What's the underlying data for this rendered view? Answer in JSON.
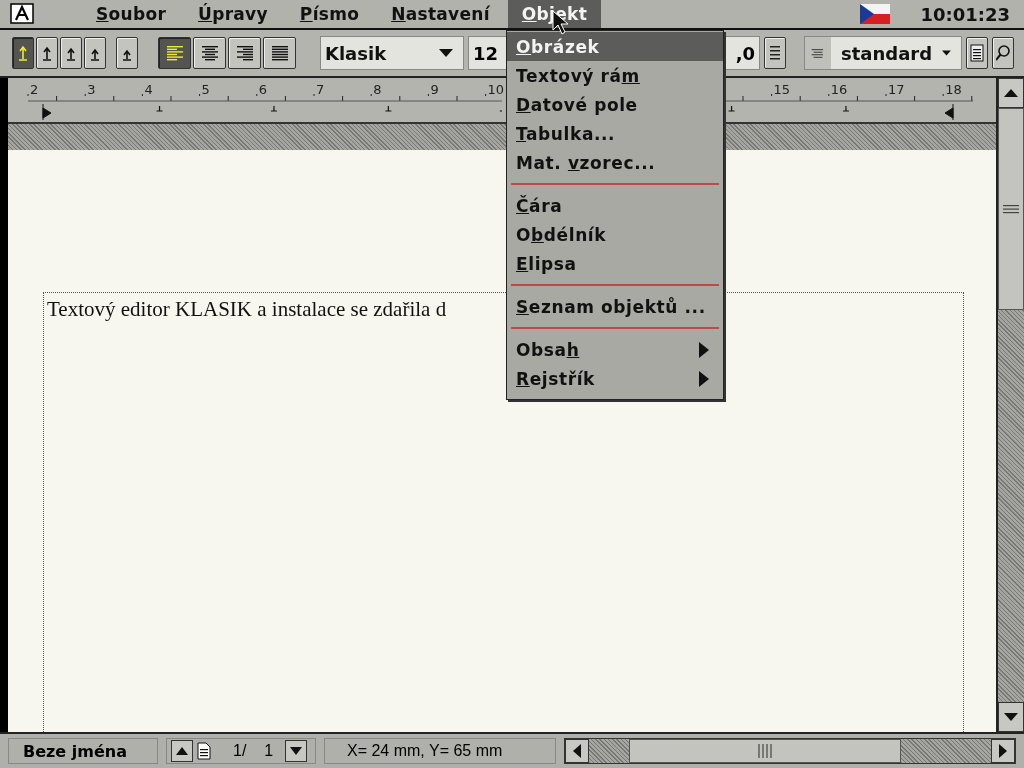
{
  "menubar": {
    "items": [
      {
        "underlined": "S",
        "after": "oubor",
        "selected": false
      },
      {
        "underlined": "Ú",
        "after": "pravy",
        "selected": false
      },
      {
        "underlined": "P",
        "after": "ísmo",
        "selected": false
      },
      {
        "underlined": "N",
        "after": "astavení",
        "selected": false
      },
      {
        "underlined": "O",
        "after": "bjekt",
        "selected": true
      }
    ],
    "clock": "10:01:23"
  },
  "toolbar": {
    "spacing_buttons": [
      {
        "selected": true
      },
      {
        "selected": false
      },
      {
        "selected": false
      },
      {
        "selected": false
      },
      {
        "selected": false
      }
    ],
    "align_buttons": [
      {
        "kind": "left",
        "selected": true
      },
      {
        "kind": "center",
        "selected": false
      },
      {
        "kind": "right",
        "selected": false
      },
      {
        "kind": "justify",
        "selected": false
      }
    ],
    "font": "Klasik",
    "size": "12",
    "spacing": ",0",
    "style": "standard"
  },
  "ruler": {
    "numbers": [
      "2",
      "3",
      "4",
      "5",
      "6",
      "7",
      "8",
      "9",
      "10",
      "15",
      "16",
      "17",
      "18"
    ]
  },
  "document": {
    "text": "Textový editor KLASIK a instalace se zdařila d"
  },
  "menu": {
    "items": [
      {
        "kind": "item",
        "underlined": "O",
        "after": "brázek",
        "selected": true
      },
      {
        "kind": "item",
        "before": "Textový rá",
        "underlined": "m",
        "selected": false
      },
      {
        "kind": "item",
        "underlined": "D",
        "after": "atové pole",
        "selected": false
      },
      {
        "kind": "item",
        "underlined": "T",
        "after": "abulka...",
        "selected": false
      },
      {
        "kind": "item",
        "before": "Mat. ",
        "underlined": "v",
        "after": "zorec...",
        "selected": false
      },
      {
        "kind": "separator"
      },
      {
        "kind": "item",
        "underlined": "Č",
        "after": "ára",
        "selected": false
      },
      {
        "kind": "item",
        "before": "O",
        "underlined": "b",
        "after": "délník",
        "selected": false
      },
      {
        "kind": "item",
        "underlined": "E",
        "after": "lipsa",
        "selected": false
      },
      {
        "kind": "separator"
      },
      {
        "kind": "item",
        "underlined": "S",
        "after": "eznam objektů ...",
        "selected": false
      },
      {
        "kind": "separator"
      },
      {
        "kind": "submenu",
        "before": "Obsa",
        "underlined": "h",
        "selected": false
      },
      {
        "kind": "submenu",
        "underlined": "R",
        "after": "ejstřík",
        "selected": false
      }
    ]
  },
  "status_bar": {
    "filename": "Beze jména",
    "page": "1/",
    "pages": "1",
    "position": "X= 24 mm, Y= 65 mm"
  }
}
